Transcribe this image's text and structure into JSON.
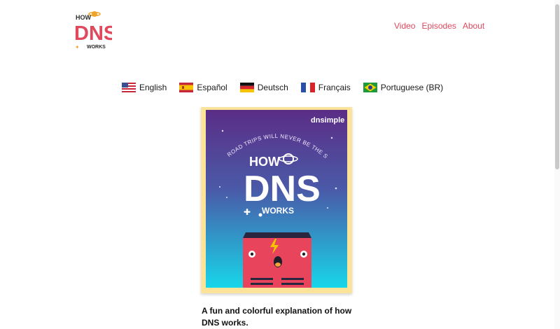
{
  "logo": {
    "line1": "HOW",
    "line2": "DNS",
    "line3": "WORKS"
  },
  "nav": [
    {
      "label": "Video"
    },
    {
      "label": "Episodes"
    },
    {
      "label": "About"
    }
  ],
  "languages": [
    {
      "label": "English",
      "flag": "us-flag"
    },
    {
      "label": "Español",
      "flag": "spain-flag"
    },
    {
      "label": "Deutsch",
      "flag": "germany-flag"
    },
    {
      "label": "Français",
      "flag": "france-flag"
    },
    {
      "label": "Portuguese (BR)",
      "flag": "brazil-flag"
    }
  ],
  "cover": {
    "brand": "dnsimple",
    "tagline": "ROAD TRIPS WILL NEVER BE THE SAME",
    "title_how": "HOW",
    "title_dns": "DNS",
    "title_works": "WORKS"
  },
  "description": {
    "line1": "A fun and colorful explanation of how",
    "line2": "DNS works."
  },
  "colors": {
    "accent": "#e0485d",
    "cover_frame": "#fbe39a",
    "cover_top": "#5b2d86",
    "cover_bottom": "#17d6ea",
    "robot": "#e8455c"
  }
}
